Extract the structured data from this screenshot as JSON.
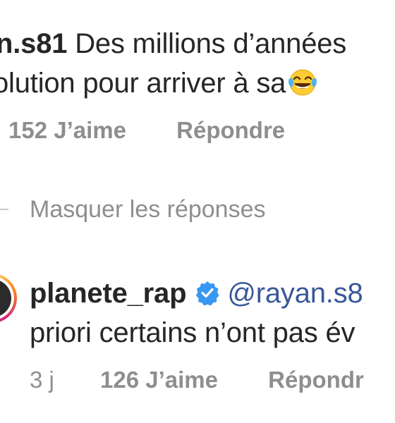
{
  "comment": {
    "username": "n.s81",
    "text_line1": "Des millions d’années",
    "text_line2": "olution pour arriver à sa",
    "emoji": "face-with-tears-of-joy-icon",
    "likes": "152 J’aime",
    "reply": "Répondre"
  },
  "hide_replies": "Masquer les réponses",
  "reply_comment": {
    "username": "planete_rap",
    "verified_icon": "verified-badge-icon",
    "mention": "@rayan.s8",
    "text_line2": "priori certains n’ont pas év",
    "time": "3 j",
    "likes": "126 J’aime",
    "reply": "Répondr"
  },
  "colors": {
    "text": "#262626",
    "meta": "#8e8e8e",
    "mention": "#385898",
    "verified": "#3897f0"
  }
}
